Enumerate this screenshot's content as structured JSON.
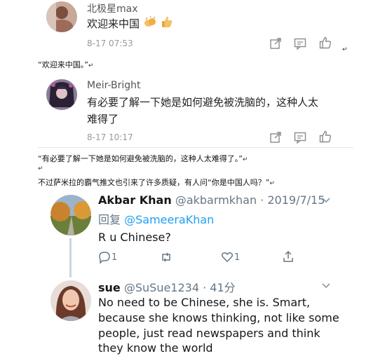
{
  "weibo": {
    "comment1": {
      "name": "北极星max",
      "text": "欢迎来中国",
      "time": "8-17 07:53"
    },
    "quote1": "“欢迎来中国。”",
    "comment2": {
      "name": "Meir-Bright",
      "text_line1": "有必要了解一下她是如何避免被洗脑的，这种人太",
      "text_line2": "难得了",
      "time": "8-17 10:17"
    },
    "quote2": "“有必要了解一下她是如何避免被洗脑的，这种人太难得了。”",
    "narrative": "不过萨米拉的霸气推文也引来了许多质疑，有人问“你是中国人吗？”"
  },
  "tweet1": {
    "display_name": "Akbar Khan",
    "handle": "@akbarmkhan",
    "dot": "·",
    "date": "2019/7/15",
    "reply_label": "回复",
    "reply_to": "@SameeraKhan",
    "text": "R u Chinese?",
    "reply_count": "1",
    "like_count": "1"
  },
  "tweet2": {
    "display_name": "sue",
    "handle": "@SuSue1234",
    "dot": "·",
    "time": "41分",
    "line1": "No need to be Chinese, she is. Smart,",
    "line2": "because she knows thinking, not like some",
    "line3": "people, just read newspapers and think",
    "line4": "they know the world"
  },
  "return_mark": "↵",
  "colors": {
    "twitter_blue": "#1da1f2",
    "twitter_gray": "#657786",
    "weibo_gray": "#999999",
    "thumb_yellow": "#f5c063"
  }
}
